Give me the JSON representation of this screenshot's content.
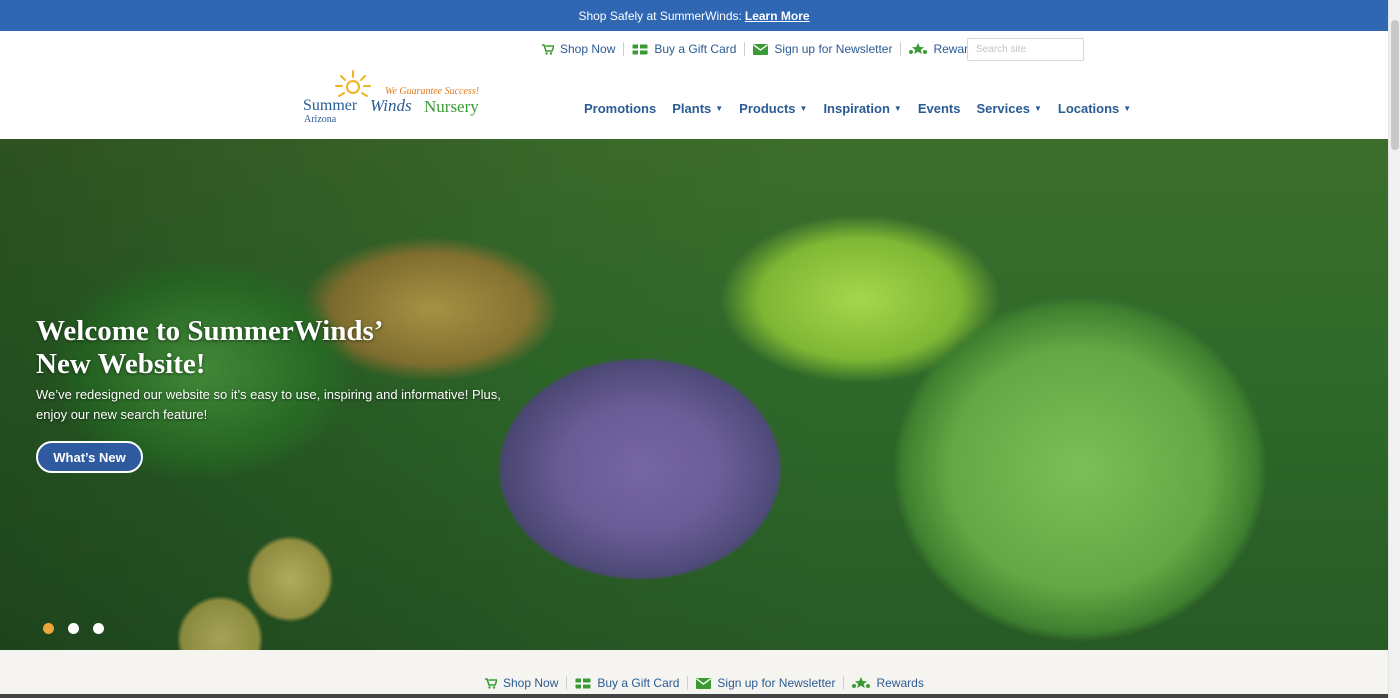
{
  "announcement": {
    "text": "Shop Safely at SummerWinds:",
    "link": "Learn More"
  },
  "utility": {
    "shop_now": "Shop Now",
    "gift_card": "Buy a Gift Card",
    "newsletter": "Sign up for Newsletter",
    "rewards": "Rewards"
  },
  "search": {
    "placeholder": "Search site"
  },
  "logo": {
    "tagline": "We Guarantee Success!",
    "name_part1": "Summer",
    "name_part2": "Winds",
    "name_part3": "Nursery",
    "region": "Arizona"
  },
  "nav": [
    {
      "label": "Promotions",
      "dropdown": false
    },
    {
      "label": "Plants",
      "dropdown": true
    },
    {
      "label": "Products",
      "dropdown": true
    },
    {
      "label": "Inspiration",
      "dropdown": true
    },
    {
      "label": "Events",
      "dropdown": false
    },
    {
      "label": "Services",
      "dropdown": true
    },
    {
      "label": "Locations",
      "dropdown": true
    }
  ],
  "hero": {
    "title_line1": "Welcome to SummerWinds’",
    "title_line2": "New Website!",
    "subtitle_line1": "We’ve redesigned our website so it’s easy to use, inspiring and informative! Plus,",
    "subtitle_line2": "enjoy our new search feature!",
    "button": "What’s New",
    "slide_count": 3,
    "active_slide": 1
  },
  "colors": {
    "primary": "#2f67b3",
    "text_blue": "#2a5b94",
    "green": "#3a9b35",
    "orange": "#f0a53a"
  },
  "icons": {
    "shop_now": "cart-icon",
    "gift_card": "gift-card-icon",
    "newsletter": "envelope-icon",
    "rewards": "rewards-icon"
  }
}
